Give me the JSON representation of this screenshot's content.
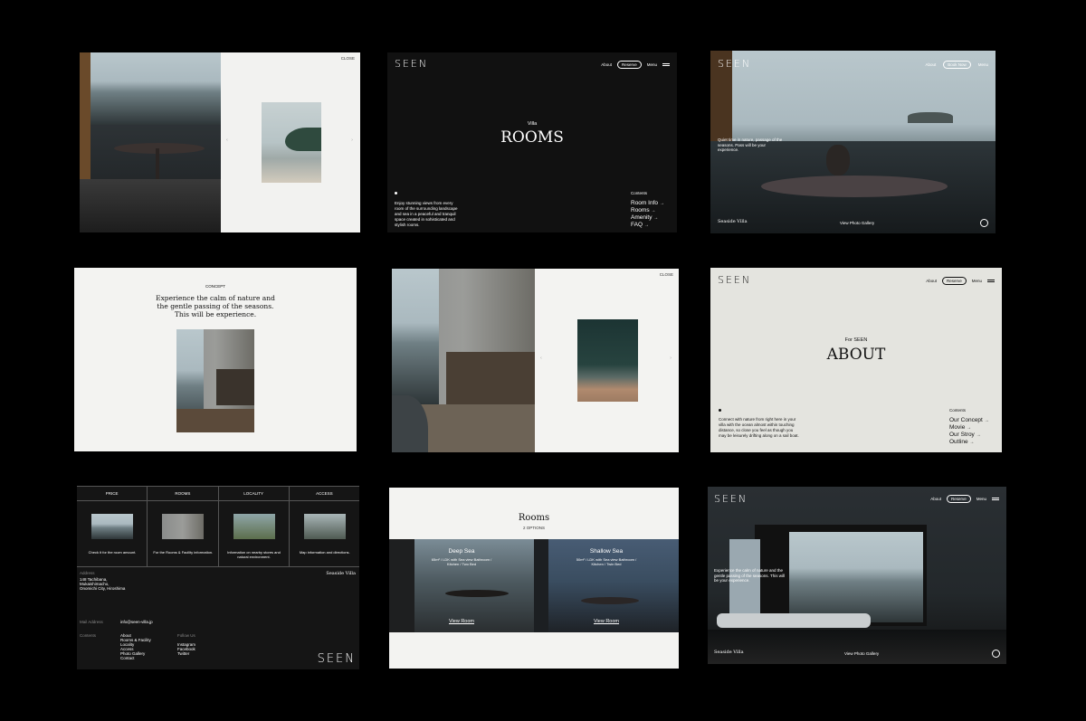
{
  "p1": {
    "close": "CLOSE",
    "prev": "‹",
    "next": "›"
  },
  "p2": {
    "logo": "SEEN",
    "nav_about": "About",
    "nav_reserve": "Reserve",
    "nav_menu": "Menu",
    "subtitle": "Villa",
    "title": "ROOMS",
    "desc": "Enjoy stunning views from every room of the surrounding landscape and sea in a peaceful and tranquil space created in sohisticated and stylish rooms.",
    "contents_label": "Contents",
    "contents": [
      "Room Info",
      "Rooms",
      "Amenity",
      "FAQ"
    ]
  },
  "p3": {
    "logo": "SEEN",
    "nav_about": "About",
    "nav_book": "Book Now",
    "nav_menu": "Menu",
    "caption": "Quiet time in nature, passage of the seasons. Pass will be your experience.",
    "footer_left": "Seaside Villa",
    "footer_center": "View Photo Gallery"
  },
  "p4": {
    "label": "CONCEPT",
    "heading": "Experience the calm of nature and the gentle passing of the seasons. This will be experience."
  },
  "p5": {
    "close": "CLOSE",
    "prev": "‹",
    "next": "›"
  },
  "p6": {
    "logo": "SEEN",
    "nav_about": "About",
    "nav_reserve": "Reserve",
    "nav_menu": "Menu",
    "subtitle": "For SEEN",
    "title": "ABOUT",
    "desc": "Connect with nature from right here in your villa with the ocean almost within touching distance, so close you feel as though you may be leisurely drifting along on a sail boat.",
    "contents_label": "Contents",
    "contents": [
      "Our Concept",
      "Movie",
      "Our Stroy",
      "Outline"
    ]
  },
  "p7": {
    "columns": [
      {
        "title": "PRICE",
        "desc": "Check it for the room amount."
      },
      {
        "title": "ROOMS",
        "desc": "For the Rooms & Facility information."
      },
      {
        "title": "LOCALITY",
        "desc": "Information on nearby stores and natural environment."
      },
      {
        "title": "ACCESS",
        "desc": "Map information and directions."
      }
    ],
    "address_label": "Address",
    "address": "148 Tachibana, Mukaishimacho, Onomichi City, Hiroshima",
    "brand_right": "Seaside Villa",
    "mail_label": "Mail Address",
    "mail": "info@seen-villa.jp",
    "contents_label": "Contents",
    "contents": [
      "About",
      "Rooms & Facility",
      "Locality",
      "Access",
      "Photo Gallery",
      "Contact"
    ],
    "follow_label": "Follow Us",
    "follow": [
      "Instagram",
      "Facebook",
      "Twitter"
    ],
    "logo": "SEEN"
  },
  "p8": {
    "title": "Rooms",
    "options": "2 OPTIONS",
    "rooms": [
      {
        "name": "Deep Sea",
        "spec": "65m² / LDK with Sea view Bathroom / Kitchen / Two Bed",
        "link": "View Room"
      },
      {
        "name": "Shallow Sea",
        "spec": "50m² / LDK with Sea view Bathroom / Kitchen / Twin Bed",
        "link": "View Room"
      }
    ]
  },
  "p9": {
    "logo": "SEEN",
    "nav_about": "About",
    "nav_reserve": "Reserve",
    "nav_menu": "Menu",
    "caption": "Experience the calm of nature and the gentle passing of the seasons. This will be your experience.",
    "footer_left": "Seaside Villa",
    "footer_center": "View Photo Gallery"
  }
}
